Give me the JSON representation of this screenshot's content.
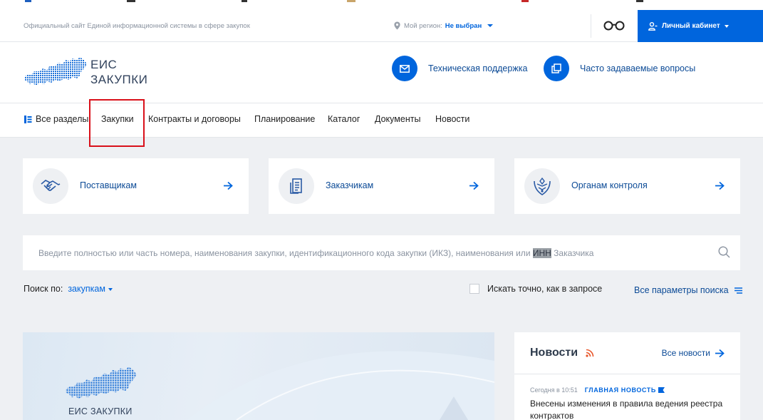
{
  "colors": {
    "accent": "#0065dd",
    "link": "#0b4a96",
    "highlight_box": "#d9101a",
    "page_bg": "#eef0f3"
  },
  "topbar": {
    "site_description": "Официальный сайт Единой информационной системы в сфере закупок",
    "region_label": "Мой регион:",
    "region_value": "Не выбран",
    "accessibility_icon": "glasses-icon",
    "cabinet_label": "Личный кабинет"
  },
  "header": {
    "logo_line1": "ЕИС",
    "logo_line2": "ЗАКУПКИ",
    "support_label": "Техническая поддержка",
    "faq_label": "Часто задаваемые вопросы"
  },
  "nav": {
    "all_sections": "Все разделы",
    "items": [
      "Закупки",
      "Контракты и договоры",
      "Планирование",
      "Каталог",
      "Документы",
      "Новости"
    ]
  },
  "cards": [
    {
      "label": "Поставщикам",
      "icon": "handshake-icon"
    },
    {
      "label": "Заказчикам",
      "icon": "document-building-icon"
    },
    {
      "label": "Органам контроля",
      "icon": "emblem-icon"
    }
  ],
  "search": {
    "placeholder_before": "Введите полностью или часть номера, наименования закупки, идентификационного кода закупки (ИКЗ), наименования или ",
    "placeholder_mark": "ИНН",
    "placeholder_after": " Заказчика",
    "search_by_label": "Поиск по:",
    "search_by_value": "закупкам",
    "exact_label": "Искать точно, как в запросе",
    "all_params_label": "Все параметры поиска"
  },
  "banner": {
    "logo_text": "ЕИС ЗАКУПКИ"
  },
  "news": {
    "title": "Новости",
    "all_news": "Все новости",
    "item": {
      "time": "Сегодня в 10:51",
      "tag": "ГЛАВНАЯ НОВОСТЬ",
      "headline": "Внесены изменения в правила ведения реестра контрактов"
    }
  }
}
